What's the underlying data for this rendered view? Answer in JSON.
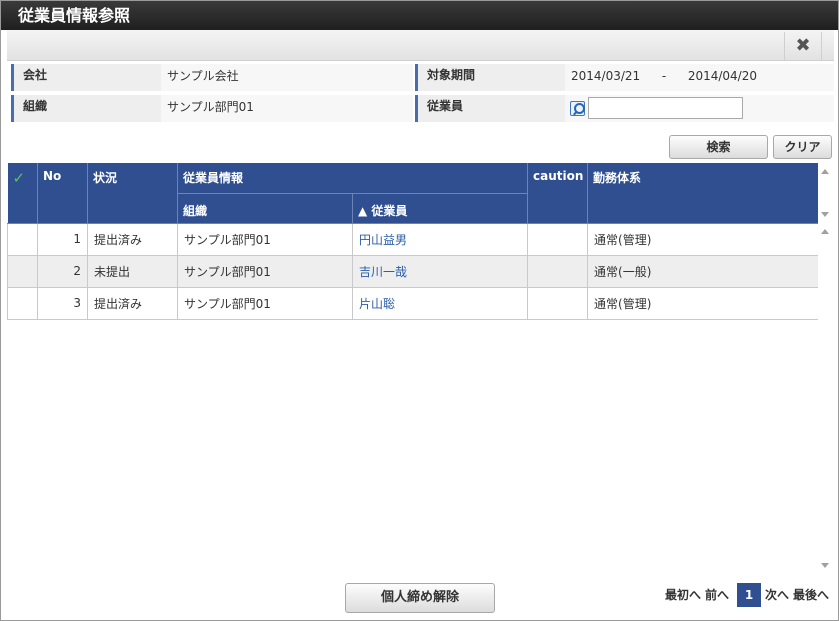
{
  "window": {
    "title": "従業員情報参照",
    "close_icon": "✖"
  },
  "conditions": {
    "company_label": "会社",
    "company_value": "サンプル会社",
    "period_label": "対象期間",
    "period_start": "2014/03/21",
    "period_sep": "-",
    "period_end": "2014/04/20",
    "org_label": "組織",
    "org_value": "サンプル部門01",
    "employee_label": "従業員",
    "employee_value": ""
  },
  "actions": {
    "search_label": "検索",
    "clear_label": "クリア"
  },
  "table": {
    "headers": {
      "check": "✓",
      "no": "No",
      "status": "状況",
      "employee_info": "従業員情報",
      "org": "組織",
      "employee": "▲ 従業員",
      "caution": "caution",
      "work_system": "勤務体系"
    },
    "rows": [
      {
        "no": "1",
        "status": "提出済み",
        "org": "サンプル部門01",
        "employee": "円山益男",
        "caution": "",
        "work_system": "通常(管理)"
      },
      {
        "no": "2",
        "status": "未提出",
        "org": "サンプル部門01",
        "employee": "吉川一哉",
        "caution": "",
        "work_system": "通常(一般)"
      },
      {
        "no": "3",
        "status": "提出済み",
        "org": "サンプル部門01",
        "employee": "片山聡",
        "caution": "",
        "work_system": "通常(管理)"
      }
    ]
  },
  "footer": {
    "release_label": "個人締め解除",
    "first": "最初へ",
    "prev": "前へ",
    "current_page": "1",
    "next": "次へ",
    "last": "最後へ"
  }
}
